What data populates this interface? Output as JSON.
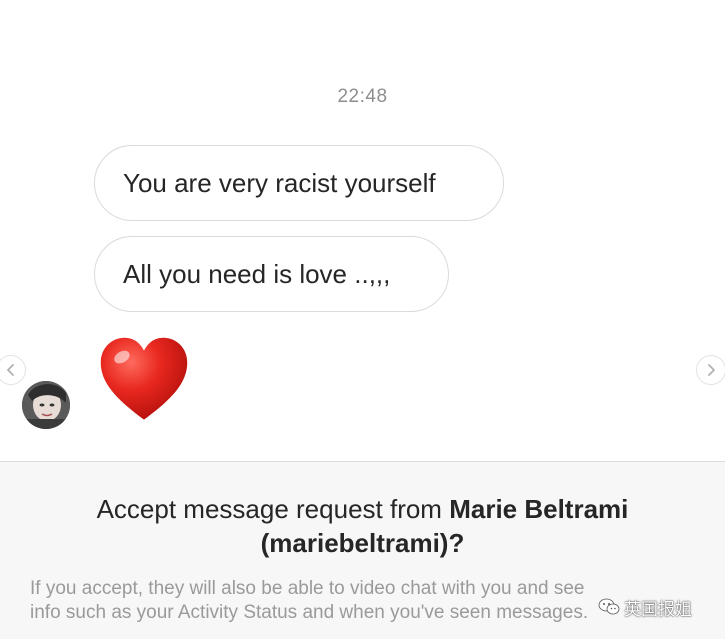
{
  "chat": {
    "timestamp": "22:48",
    "messages": [
      {
        "text": "You are very racist yourself"
      },
      {
        "text": "All you need is love ..,,,"
      }
    ],
    "emoji_message": "heart-emoji"
  },
  "request": {
    "title_prefix": "Accept message request from ",
    "sender_name": "Marie Beltrami",
    "sender_handle_line": "(mariebeltrami)?",
    "body_line_1": "If you accept, they will also be able to video chat with you and see",
    "body_line_2": "info such as your Activity Status and when you've seen messages."
  },
  "watermark": {
    "label": "英国报姐"
  },
  "colors": {
    "bubble_border": "#dbdbdb",
    "heart": "#e0201b",
    "panel_bg": "#f7f7f7",
    "muted_text": "#9a9a9a"
  }
}
